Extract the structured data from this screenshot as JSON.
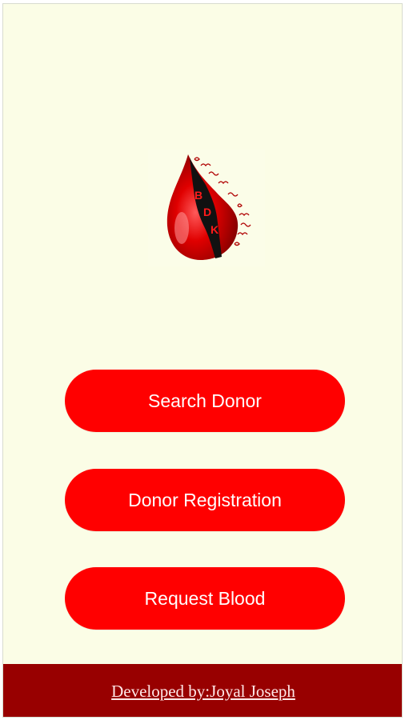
{
  "colors": {
    "background": "#fbfde6",
    "button": "#ff0000",
    "button_text": "#ffffff",
    "footer": "#980000",
    "footer_text": "#ffe8e8"
  },
  "logo": {
    "icon": "blood-drop-kerala-map-logo",
    "letters": [
      "B",
      "D",
      "K"
    ]
  },
  "buttons": {
    "search_donor": "Search Donor",
    "donor_registration": "Donor Registration",
    "request_blood": "Request Blood"
  },
  "footer": {
    "credit": "Developed by:Joyal Joseph"
  }
}
